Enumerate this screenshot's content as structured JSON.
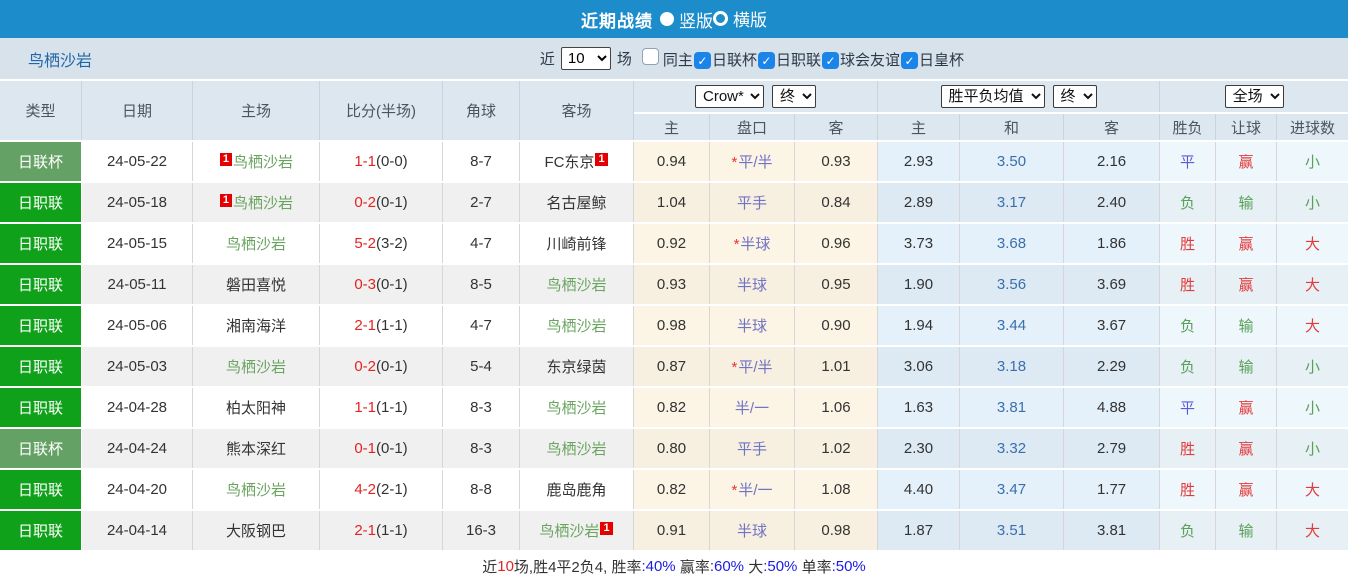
{
  "title_bar": {
    "title": "近期战绩",
    "layout_options": [
      {
        "label": "竖版",
        "selected": true
      },
      {
        "label": "横版",
        "selected": false
      }
    ]
  },
  "filter_bar": {
    "team_name": "鸟栖沙岩",
    "near_label": "近",
    "count_value": "10",
    "matches_label": "场",
    "checkboxes": [
      {
        "label": "同主",
        "checked": false
      },
      {
        "label": "日联杯",
        "checked": true
      },
      {
        "label": "日职联",
        "checked": true
      },
      {
        "label": "球会友谊",
        "checked": true
      },
      {
        "label": "日皇杯",
        "checked": true
      }
    ]
  },
  "table": {
    "main_headers": [
      "类型",
      "日期",
      "主场",
      "比分(半场)",
      "角球",
      "客场"
    ],
    "odds_group": {
      "select_company": "Crow*",
      "select_final": "终"
    },
    "avg_group": {
      "select_type": "胜平负均值",
      "select_final": "终"
    },
    "scope_group": {
      "select_scope": "全场"
    },
    "sub_headers": [
      "主",
      "盘口",
      "客",
      "主",
      "和",
      "客",
      "胜负",
      "让球",
      "进球数"
    ],
    "rows": [
      {
        "type": "日联杯",
        "type_class": "t-cup",
        "date": "24-05-22",
        "home": {
          "name": "鸟栖沙岩",
          "focus": true,
          "badge_pre": "1"
        },
        "score_ft": "1-1",
        "score_ht": "(0-0)",
        "corners": "8-7",
        "away": {
          "name": "FC东京",
          "focus": false,
          "badge_post": "1"
        },
        "odds_home": "0.94",
        "handicap": "平/半",
        "handicap_star": true,
        "odds_away": "0.93",
        "avg_home": "2.93",
        "avg_draw": "3.50",
        "avg_away": "2.16",
        "res_wdl": {
          "text": "平",
          "color": "c-blue"
        },
        "res_handicap": {
          "text": "赢",
          "color": "c-red"
        },
        "res_goals": {
          "text": "小",
          "color": "c-green"
        }
      },
      {
        "type": "日职联",
        "type_class": "t-league",
        "date": "24-05-18",
        "home": {
          "name": "鸟栖沙岩",
          "focus": true,
          "badge_pre": "1"
        },
        "score_ft": "0-2",
        "score_ht": "(0-1)",
        "corners": "2-7",
        "away": {
          "name": "名古屋鲸",
          "focus": false
        },
        "odds_home": "1.04",
        "handicap": "平手",
        "handicap_star": false,
        "odds_away": "0.84",
        "avg_home": "2.89",
        "avg_draw": "3.17",
        "avg_away": "2.40",
        "res_wdl": {
          "text": "负",
          "color": "c-green"
        },
        "res_handicap": {
          "text": "输",
          "color": "c-green"
        },
        "res_goals": {
          "text": "小",
          "color": "c-green"
        }
      },
      {
        "type": "日职联",
        "type_class": "t-league",
        "date": "24-05-15",
        "home": {
          "name": "鸟栖沙岩",
          "focus": true
        },
        "score_ft": "5-2",
        "score_ht": "(3-2)",
        "corners": "4-7",
        "away": {
          "name": "川崎前锋",
          "focus": false
        },
        "odds_home": "0.92",
        "handicap": "半球",
        "handicap_star": true,
        "odds_away": "0.96",
        "avg_home": "3.73",
        "avg_draw": "3.68",
        "avg_away": "1.86",
        "res_wdl": {
          "text": "胜",
          "color": "c-red"
        },
        "res_handicap": {
          "text": "赢",
          "color": "c-red"
        },
        "res_goals": {
          "text": "大",
          "color": "c-red"
        }
      },
      {
        "type": "日职联",
        "type_class": "t-league",
        "date": "24-05-11",
        "home": {
          "name": "磐田喜悦",
          "focus": false
        },
        "score_ft": "0-3",
        "score_ht": "(0-1)",
        "corners": "8-5",
        "away": {
          "name": "鸟栖沙岩",
          "focus": true
        },
        "odds_home": "0.93",
        "handicap": "半球",
        "handicap_star": false,
        "odds_away": "0.95",
        "avg_home": "1.90",
        "avg_draw": "3.56",
        "avg_away": "3.69",
        "res_wdl": {
          "text": "胜",
          "color": "c-red"
        },
        "res_handicap": {
          "text": "赢",
          "color": "c-red"
        },
        "res_goals": {
          "text": "大",
          "color": "c-red"
        }
      },
      {
        "type": "日职联",
        "type_class": "t-league",
        "date": "24-05-06",
        "home": {
          "name": "湘南海洋",
          "focus": false
        },
        "score_ft": "2-1",
        "score_ht": "(1-1)",
        "corners": "4-7",
        "away": {
          "name": "鸟栖沙岩",
          "focus": true
        },
        "odds_home": "0.98",
        "handicap": "半球",
        "handicap_star": false,
        "odds_away": "0.90",
        "avg_home": "1.94",
        "avg_draw": "3.44",
        "avg_away": "3.67",
        "res_wdl": {
          "text": "负",
          "color": "c-green"
        },
        "res_handicap": {
          "text": "输",
          "color": "c-green"
        },
        "res_goals": {
          "text": "大",
          "color": "c-red"
        }
      },
      {
        "type": "日职联",
        "type_class": "t-league",
        "date": "24-05-03",
        "home": {
          "name": "鸟栖沙岩",
          "focus": true
        },
        "score_ft": "0-2",
        "score_ht": "(0-1)",
        "corners": "5-4",
        "away": {
          "name": "东京绿茵",
          "focus": false
        },
        "odds_home": "0.87",
        "handicap": "平/半",
        "handicap_star": true,
        "odds_away": "1.01",
        "avg_home": "3.06",
        "avg_draw": "3.18",
        "avg_away": "2.29",
        "res_wdl": {
          "text": "负",
          "color": "c-green"
        },
        "res_handicap": {
          "text": "输",
          "color": "c-green"
        },
        "res_goals": {
          "text": "小",
          "color": "c-green"
        }
      },
      {
        "type": "日职联",
        "type_class": "t-league",
        "date": "24-04-28",
        "home": {
          "name": "柏太阳神",
          "focus": false
        },
        "score_ft": "1-1",
        "score_ht": "(1-1)",
        "corners": "8-3",
        "away": {
          "name": "鸟栖沙岩",
          "focus": true
        },
        "odds_home": "0.82",
        "handicap": "半/一",
        "handicap_star": false,
        "odds_away": "1.06",
        "avg_home": "1.63",
        "avg_draw": "3.81",
        "avg_away": "4.88",
        "res_wdl": {
          "text": "平",
          "color": "c-blue"
        },
        "res_handicap": {
          "text": "赢",
          "color": "c-red"
        },
        "res_goals": {
          "text": "小",
          "color": "c-green"
        }
      },
      {
        "type": "日联杯",
        "type_class": "t-cup",
        "date": "24-04-24",
        "home": {
          "name": "熊本深红",
          "focus": false
        },
        "score_ft": "0-1",
        "score_ht": "(0-1)",
        "corners": "8-3",
        "away": {
          "name": "鸟栖沙岩",
          "focus": true
        },
        "odds_home": "0.80",
        "handicap": "平手",
        "handicap_star": false,
        "odds_away": "1.02",
        "avg_home": "2.30",
        "avg_draw": "3.32",
        "avg_away": "2.79",
        "res_wdl": {
          "text": "胜",
          "color": "c-red"
        },
        "res_handicap": {
          "text": "赢",
          "color": "c-red"
        },
        "res_goals": {
          "text": "小",
          "color": "c-green"
        }
      },
      {
        "type": "日职联",
        "type_class": "t-league",
        "date": "24-04-20",
        "home": {
          "name": "鸟栖沙岩",
          "focus": true
        },
        "score_ft": "4-2",
        "score_ht": "(2-1)",
        "corners": "8-8",
        "away": {
          "name": "鹿岛鹿角",
          "focus": false
        },
        "odds_home": "0.82",
        "handicap": "半/一",
        "handicap_star": true,
        "odds_away": "1.08",
        "avg_home": "4.40",
        "avg_draw": "3.47",
        "avg_away": "1.77",
        "res_wdl": {
          "text": "胜",
          "color": "c-red"
        },
        "res_handicap": {
          "text": "赢",
          "color": "c-red"
        },
        "res_goals": {
          "text": "大",
          "color": "c-red"
        }
      },
      {
        "type": "日职联",
        "type_class": "t-league",
        "date": "24-04-14",
        "home": {
          "name": "大阪钢巴",
          "focus": false
        },
        "score_ft": "2-1",
        "score_ht": "(1-1)",
        "corners": "16-3",
        "away": {
          "name": "鸟栖沙岩",
          "focus": true,
          "badge_post": "1"
        },
        "odds_home": "0.91",
        "handicap": "半球",
        "handicap_star": false,
        "odds_away": "0.98",
        "avg_home": "1.87",
        "avg_draw": "3.51",
        "avg_away": "3.81",
        "res_wdl": {
          "text": "负",
          "color": "c-green"
        },
        "res_handicap": {
          "text": "输",
          "color": "c-green"
        },
        "res_goals": {
          "text": "大",
          "color": "c-red"
        }
      }
    ]
  },
  "summary": {
    "segments": [
      {
        "text": "近",
        "color": "s-dark"
      },
      {
        "text": "10",
        "color": "s-red"
      },
      {
        "text": "场,胜4平2负4, 胜率",
        "color": "s-dark"
      },
      {
        "text": ":40%",
        "color": "s-blue"
      },
      {
        "text": " 赢率",
        "color": "s-dark"
      },
      {
        "text": ":60%",
        "color": "s-blue"
      },
      {
        "text": " 大",
        "color": "s-dark"
      },
      {
        "text": ":50%",
        "color": "s-blue"
      },
      {
        "text": " 单率",
        "color": "s-dark"
      },
      {
        "text": ":50%",
        "color": "s-blue"
      }
    ]
  },
  "colors": {
    "title_bar_bg": "#1d8ccb",
    "filter_bar_bg": "#d8e2eb",
    "header_bg": "#dde7f0",
    "cup_green": "#64a164",
    "league_green": "#0fa11a",
    "focus_team_green": "#69a45f",
    "score_red": "#e52222",
    "handicap_purple": "#7173c5",
    "avg_draw_blue": "#3a6fae",
    "badge_red": "#e40000",
    "checkbox_blue": "#1b84e8"
  }
}
